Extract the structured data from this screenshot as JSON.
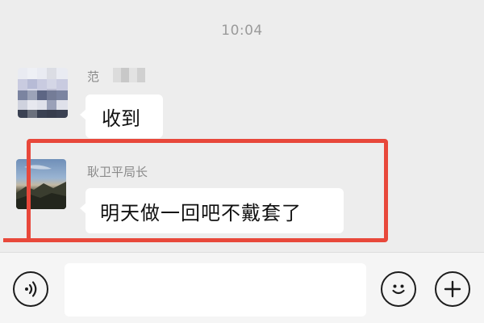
{
  "chat": {
    "timestamp": "10:04",
    "messages": [
      {
        "sender": "范",
        "text": "收到",
        "avatar_icon": "blurred-avatar-icon"
      },
      {
        "sender": "耿卫平局长",
        "text": "明天做一回吧不戴套了",
        "avatar_icon": "mountain-landscape-avatar-icon"
      }
    ]
  },
  "annotation": {
    "highlight_color": "#e8483b"
  },
  "input_bar": {
    "placeholder": "",
    "icons": [
      "voice-icon",
      "emoji-icon",
      "plus-icon"
    ]
  },
  "colors": {
    "chat_background": "#ededed",
    "bubble": "#ffffff",
    "input_bar": "#f5f5f5"
  }
}
